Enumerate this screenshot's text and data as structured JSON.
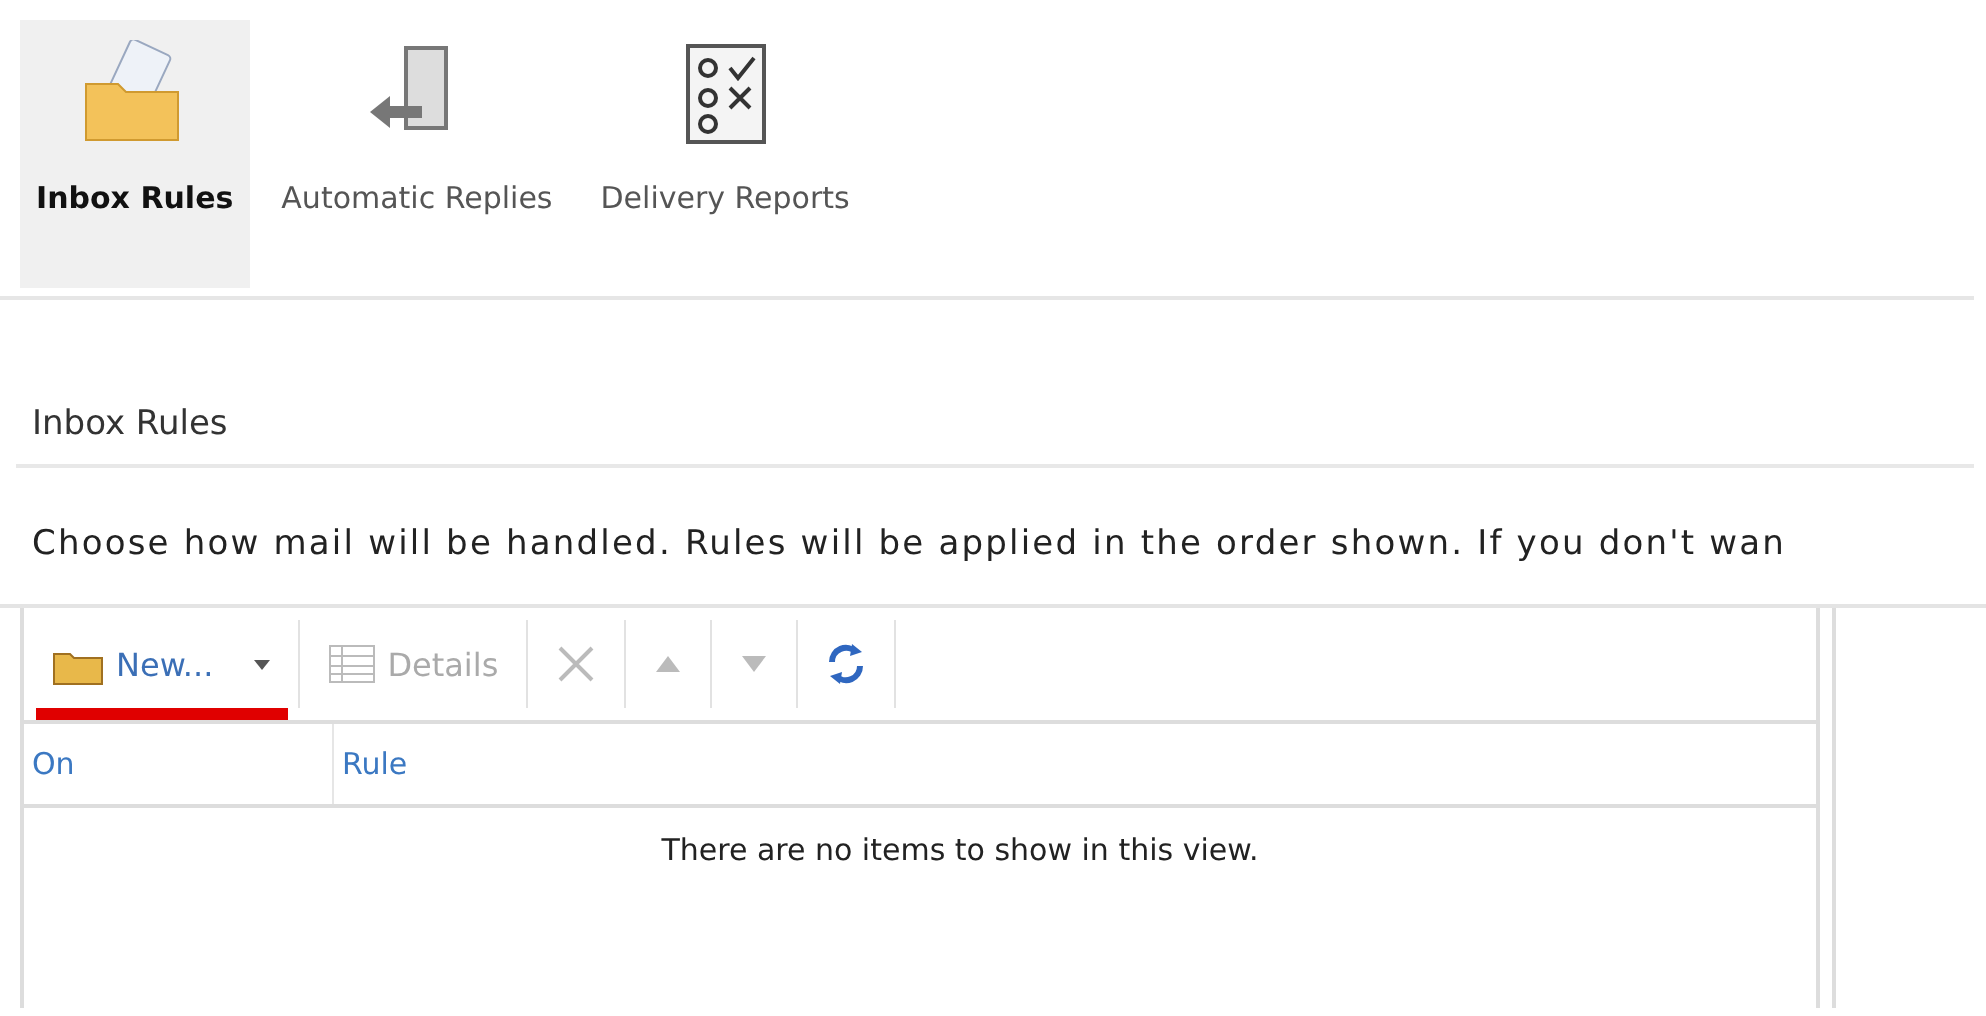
{
  "tabs": [
    {
      "label": "Inbox Rules",
      "kind": "folder",
      "selected": true
    },
    {
      "label": "Automatic Replies",
      "kind": "door",
      "selected": false
    },
    {
      "label": "Delivery Reports",
      "kind": "checklist",
      "selected": false
    }
  ],
  "section_title": "Inbox Rules",
  "description": "Choose how mail will be handled. Rules will be applied in the order shown. If you don't wan",
  "toolbar": [
    {
      "kind": "new",
      "label": "New...",
      "disabled": false,
      "highlighted": true
    },
    {
      "kind": "details",
      "label": "Details",
      "disabled": true
    },
    {
      "kind": "delete",
      "disabled": true
    },
    {
      "kind": "up",
      "disabled": true
    },
    {
      "kind": "down",
      "disabled": true
    },
    {
      "kind": "refresh",
      "disabled": false
    }
  ],
  "table": {
    "columns": [
      "On",
      "Rule"
    ],
    "empty_message": "There are no items to show in this view."
  }
}
